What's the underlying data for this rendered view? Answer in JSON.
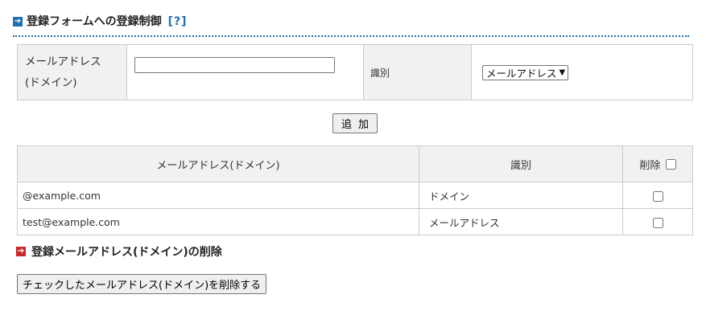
{
  "section1": {
    "title": "登録フォームへの登録制御",
    "help_link": "[?]",
    "icon": "arrow-right-icon",
    "accent": "#1f6fb2"
  },
  "form": {
    "email_label_line1": "メールアドレス",
    "email_label_line2": "(ドメイン)",
    "email_value": "",
    "type_label": "識別",
    "type_selected": "メールアドレス",
    "add_button": "追加"
  },
  "list": {
    "headers": {
      "address": "メールアドレス(ドメイン)",
      "type": "識別",
      "delete": "削除"
    },
    "rows": [
      {
        "address": "@example.com",
        "type": "ドメイン",
        "checked": false
      },
      {
        "address": "test@example.com",
        "type": "メールアドレス",
        "checked": false
      }
    ]
  },
  "section2": {
    "title": "登録メールアドレス(ドメイン)の削除",
    "icon": "arrow-right-icon",
    "accent": "#c82a2a",
    "delete_button": "チェックしたメールアドレス(ドメイン)を削除する"
  }
}
